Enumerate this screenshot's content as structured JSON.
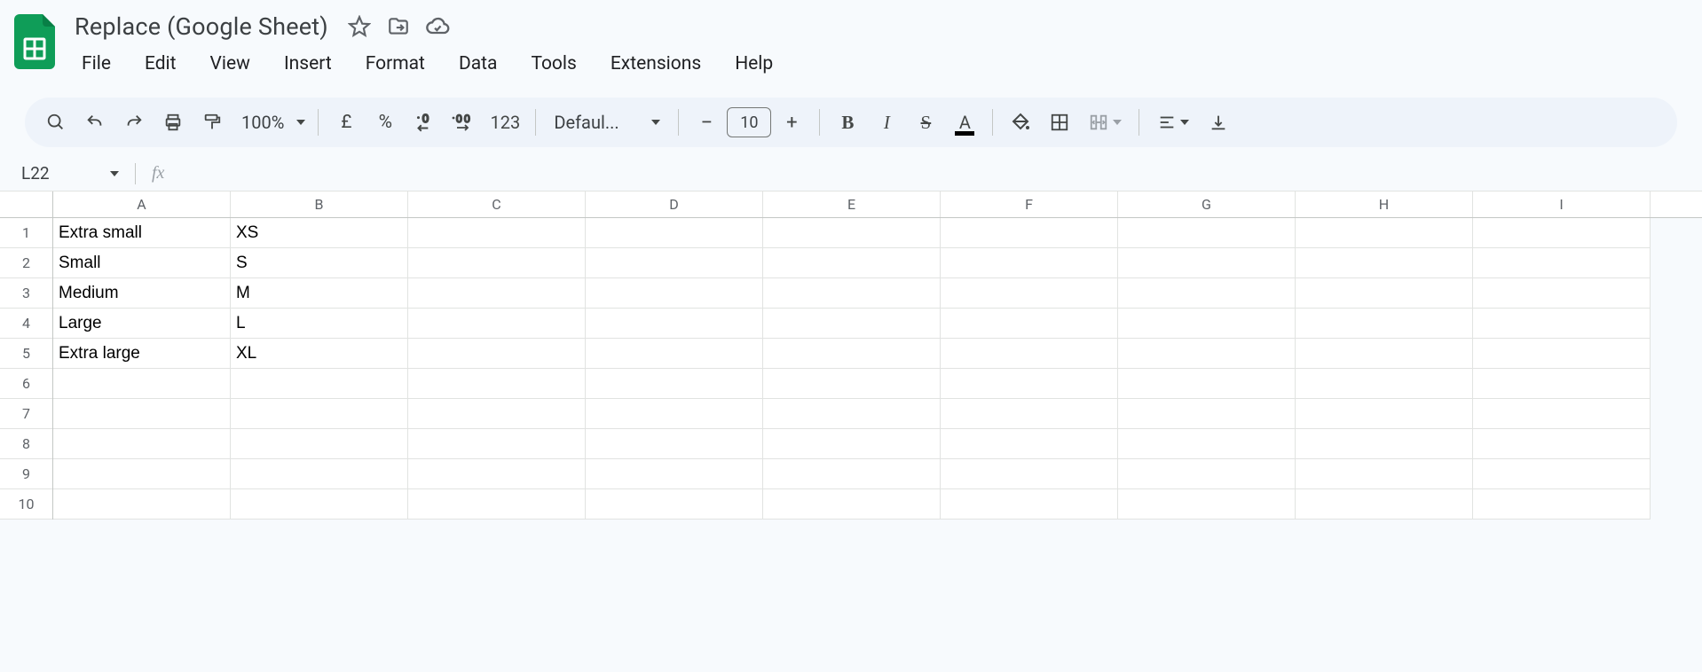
{
  "header": {
    "title": "Replace (Google Sheet)",
    "menu": [
      "File",
      "Edit",
      "View",
      "Insert",
      "Format",
      "Data",
      "Tools",
      "Extensions",
      "Help"
    ]
  },
  "toolbar": {
    "zoom": "100%",
    "currency": "£",
    "percent": "%",
    "dec_decrease": ".0",
    "dec_increase": ".00",
    "num_format": "123",
    "font_name": "Defaul...",
    "font_size": "10",
    "bold": "B",
    "italic": "I",
    "strike": "S",
    "text_color": "A"
  },
  "namebox": {
    "ref": "L22"
  },
  "formula": {
    "fx_label": "fx",
    "value": ""
  },
  "grid": {
    "columns": [
      "A",
      "B",
      "C",
      "D",
      "E",
      "F",
      "G",
      "H",
      "I"
    ],
    "rows": [
      "1",
      "2",
      "3",
      "4",
      "5",
      "6",
      "7",
      "8",
      "9",
      "10"
    ],
    "data": [
      {
        "A": "Extra small",
        "B": "XS"
      },
      {
        "A": "Small",
        "B": "S"
      },
      {
        "A": "Medium",
        "B": "M"
      },
      {
        "A": "Large",
        "B": "L"
      },
      {
        "A": "Extra large",
        "B": "XL"
      },
      {},
      {},
      {},
      {},
      {}
    ]
  }
}
